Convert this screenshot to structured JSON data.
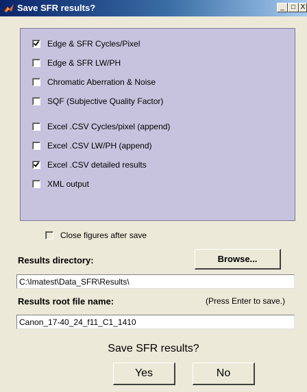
{
  "window": {
    "title": "Save SFR results?",
    "minimize_glyph": "_",
    "maximize_glyph": "□",
    "close_glyph": "X",
    "title_icon": "matlab-icon"
  },
  "options": [
    {
      "label": "Edge & SFR Cycles/Pixel",
      "checked": true
    },
    {
      "label": "Edge & SFR LW/PH",
      "checked": false
    },
    {
      "label": "Chromatic Aberration & Noise",
      "checked": false
    },
    {
      "label": "SQF (Subjective Quality Factor)",
      "checked": false
    },
    {
      "label": "Excel .CSV Cycles/pixel (append)",
      "checked": false
    },
    {
      "label": "Excel .CSV LW/PH (append)",
      "checked": false
    },
    {
      "label": "Excel .CSV detailed results",
      "checked": true
    },
    {
      "label": "XML output",
      "checked": false
    }
  ],
  "close_figures": {
    "label": "Close figures after save",
    "checked": false
  },
  "results_directory": {
    "label": "Results directory:",
    "browse_label": "Browse...",
    "value": "C:\\Imatest\\Data_SFR\\Results\\"
  },
  "results_root": {
    "label": "Results root file name:",
    "hint": "(Press Enter to save.)",
    "value": "Canon_17-40_24_f11_C1_1410"
  },
  "prompt": {
    "question": "Save SFR results?",
    "yes_label": "Yes",
    "no_label": "No"
  },
  "colors": {
    "group_background": "#c7c3de",
    "dialog_background": "#ece9d8",
    "titlebar_start": "#0a246a",
    "titlebar_end": "#a6caf0"
  }
}
